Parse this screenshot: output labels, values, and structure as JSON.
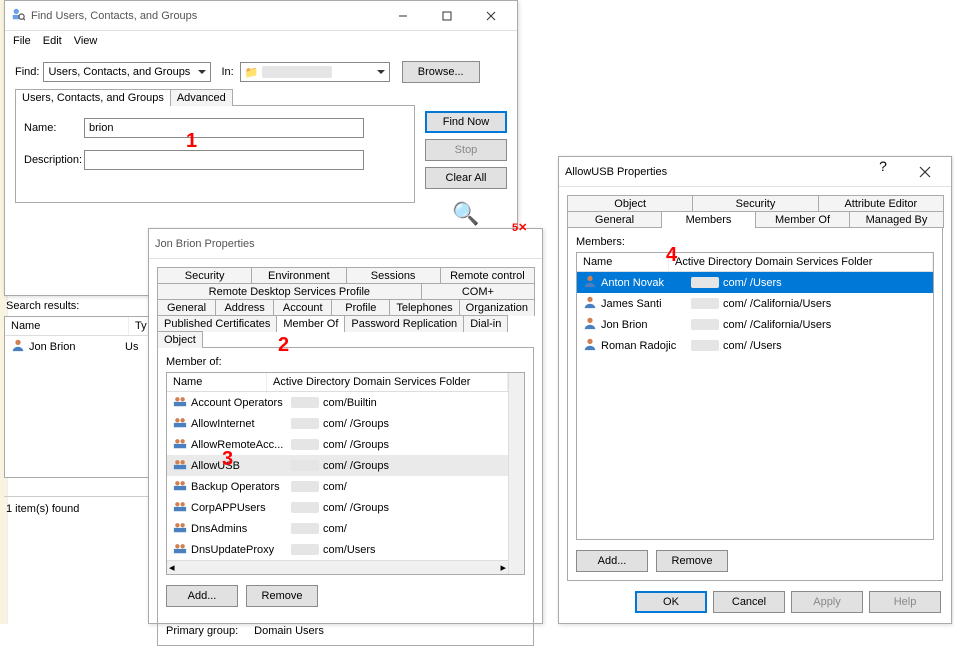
{
  "find_window": {
    "title": "Find Users, Contacts, and Groups",
    "menu": {
      "file": "File",
      "edit": "Edit",
      "view": "View"
    },
    "find_label": "Find:",
    "find_value": "Users, Contacts, and Groups",
    "in_label": "In:",
    "in_value": "",
    "browse": "Browse...",
    "tabs": {
      "ucg": "Users, Contacts, and Groups",
      "adv": "Advanced"
    },
    "name_label": "Name:",
    "name_value": "brion",
    "desc_label": "Description:",
    "desc_value": "",
    "find_now": "Find Now",
    "stop": "Stop",
    "clear_all": "Clear All",
    "results_label": "Search results:",
    "col_name": "Name",
    "col_type": "Ty",
    "row_name": "Jon Brion",
    "row_type": "Us",
    "status": "1 item(s) found"
  },
  "props_window": {
    "title": "Jon Brion Properties",
    "tabs_r1": [
      "Security",
      "Environment",
      "Sessions",
      "Remote control"
    ],
    "tabs_r2": [
      "Remote Desktop Services Profile",
      "COM+"
    ],
    "tabs_r3": [
      "General",
      "Address",
      "Account",
      "Profile",
      "Telephones",
      "Organization"
    ],
    "tabs_r4": [
      "Published Certificates",
      "Member Of",
      "Password Replication",
      "Dial-in",
      "Object"
    ],
    "active_tab": "Member Of",
    "memberof_label": "Member of:",
    "col_name": "Name",
    "col_folder": "Active Directory Domain Services Folder",
    "rows": [
      {
        "n": "Account Operators",
        "f": "com/Builtin"
      },
      {
        "n": "AllowInternet",
        "f": "com/    /Groups"
      },
      {
        "n": "AllowRemoteAcc...",
        "f": "com/    /Groups"
      },
      {
        "n": "AllowUSB",
        "f": "com/    /Groups"
      },
      {
        "n": "Backup Operators",
        "f": "com/    "
      },
      {
        "n": "CorpAPPUsers",
        "f": "com/    /Groups"
      },
      {
        "n": "DnsAdmins",
        "f": "com/    "
      },
      {
        "n": "DnsUpdateProxy",
        "f": "com/Users"
      }
    ],
    "add": "Add...",
    "remove": "Remove",
    "primary_label": "Primary group:",
    "primary_value": "Domain Users"
  },
  "allow_window": {
    "title": "AllowUSB Properties",
    "tabs_r1": [
      "Object",
      "Security",
      "Attribute Editor"
    ],
    "tabs_r2": [
      "General",
      "Members",
      "Member Of",
      "Managed By"
    ],
    "active_tab": "Members",
    "members_label": "Members:",
    "col_name": "Name",
    "col_folder": "Active Directory Domain Services Folder",
    "rows": [
      {
        "n": "Anton Novak",
        "f": "com/    /Users",
        "sel": true
      },
      {
        "n": "James Santi",
        "f": "com/    /California/Users"
      },
      {
        "n": "Jon Brion",
        "f": "com/    /California/Users"
      },
      {
        "n": "Roman Radojic",
        "f": "com/    /Users"
      }
    ],
    "add": "Add...",
    "remove": "Remove",
    "ok": "OK",
    "cancel": "Cancel",
    "apply": "Apply",
    "help": "Help"
  },
  "annotations": {
    "a1": "1",
    "a2": "2",
    "a3": "3",
    "a4": "4",
    "a5": "5"
  }
}
